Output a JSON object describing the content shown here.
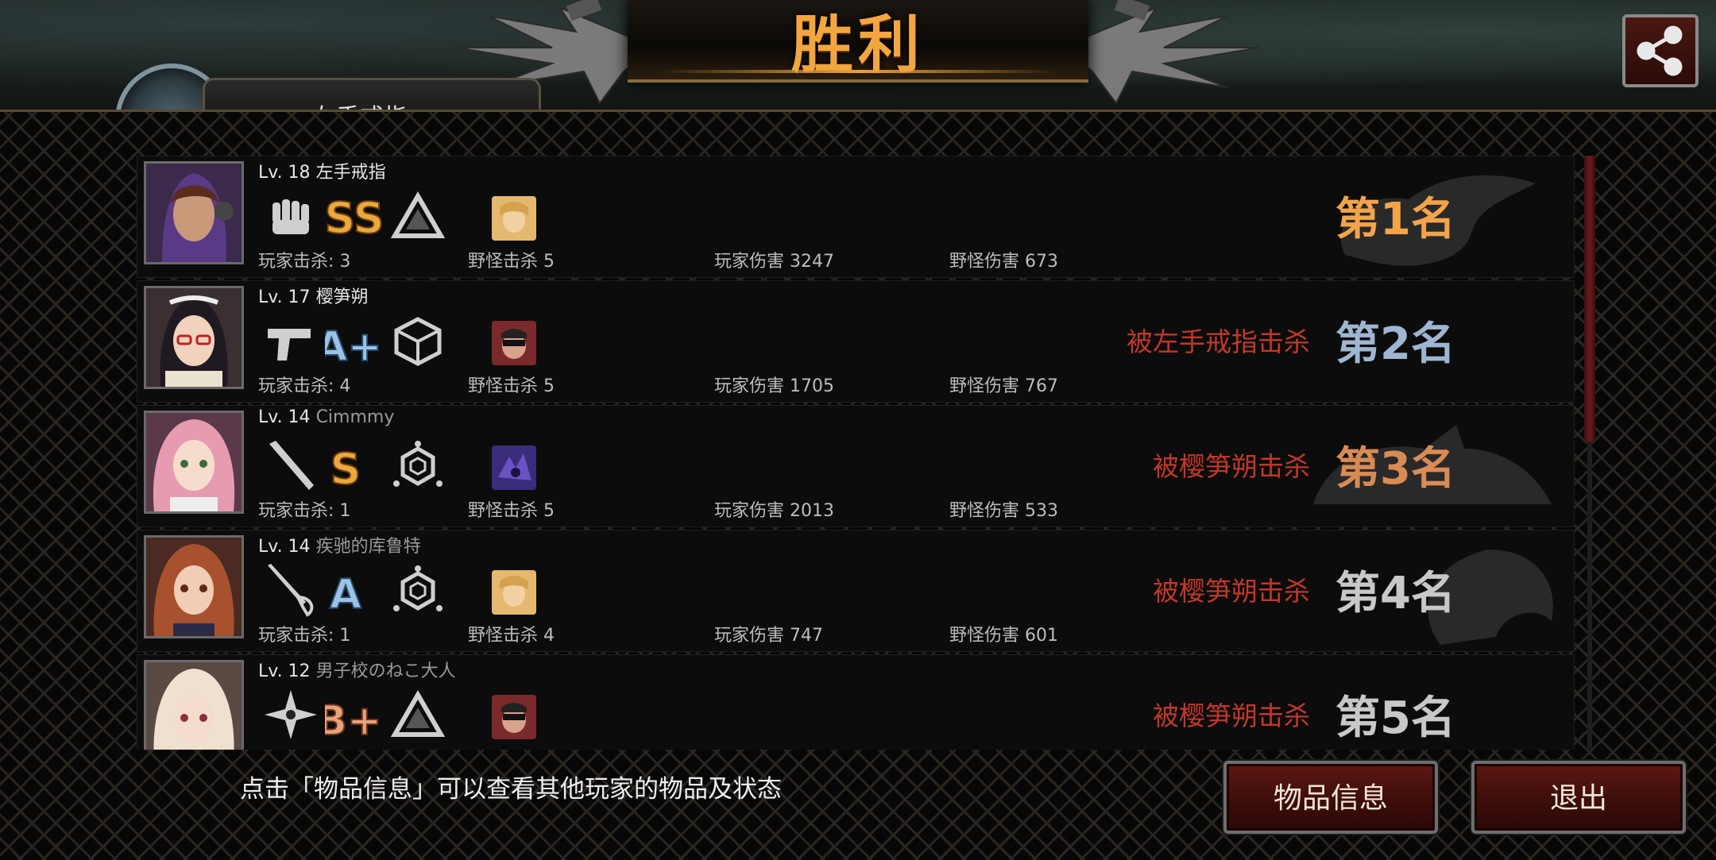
{
  "title": "胜利",
  "behind_tab_label": "左手戒指",
  "hint": "点击「物品信息」可以查看其他玩家的物品及状态",
  "buttons": {
    "item_info": "物品信息",
    "exit": "退出"
  },
  "players": [
    {
      "level": "Lv. 18",
      "name": "左手戒指",
      "grade": "SS",
      "player_kills": "玩家击杀: 3",
      "monster_kills": "野怪击杀 5",
      "player_damage": "玩家伤害 3247",
      "monster_damage": "野怪伤害 673",
      "killed_by": "",
      "rank": "第1名",
      "rank_color": "#f3a44a"
    },
    {
      "level": "Lv. 17",
      "name": "樱笋朔",
      "grade": "A+",
      "player_kills": "玩家击杀: 4",
      "monster_kills": "野怪击杀 5",
      "player_damage": "玩家伤害 1705",
      "monster_damage": "野怪伤害 767",
      "killed_by": "被左手戒指击杀",
      "rank": "第2名",
      "rank_color": "#9fb6d2"
    },
    {
      "level": "Lv. 14",
      "name": "Cimmmy",
      "grade": "S",
      "player_kills": "玩家击杀: 1",
      "monster_kills": "野怪击杀 5",
      "player_damage": "玩家伤害 2013",
      "monster_damage": "野怪伤害 533",
      "killed_by": "被樱笋朔击杀",
      "rank": "第3名",
      "rank_color": "#d98b55"
    },
    {
      "level": "Lv. 14",
      "name": "疾驰的库鲁特",
      "grade": "A",
      "player_kills": "玩家击杀: 1",
      "monster_kills": "野怪击杀 4",
      "player_damage": "玩家伤害 747",
      "monster_damage": "野怪伤害 601",
      "killed_by": "被樱笋朔击杀",
      "rank": "第4名",
      "rank_color": "#c8c8c8"
    },
    {
      "level": "Lv. 12",
      "name": "男子校のねこ大人",
      "grade": "B+",
      "player_kills": "",
      "monster_kills": "",
      "player_damage": "",
      "monster_damage": "",
      "killed_by": "被樱笋朔击杀",
      "rank": "第5名",
      "rank_color": "#c8c8c8"
    }
  ],
  "icons": {
    "weapons": [
      "fist-icon",
      "pistol-icon",
      "bat-icon",
      "rapier-icon",
      "shuriken-icon"
    ],
    "armor": [
      "triangle-rune-icon",
      "cube-rune-icon",
      "hex-rune-icon",
      "hex-rune-icon",
      "triangle-rune-icon"
    ]
  },
  "colors": {
    "accent": "#f2a640",
    "killed_text": "#c3372a",
    "button_bg": "#4a120e"
  }
}
